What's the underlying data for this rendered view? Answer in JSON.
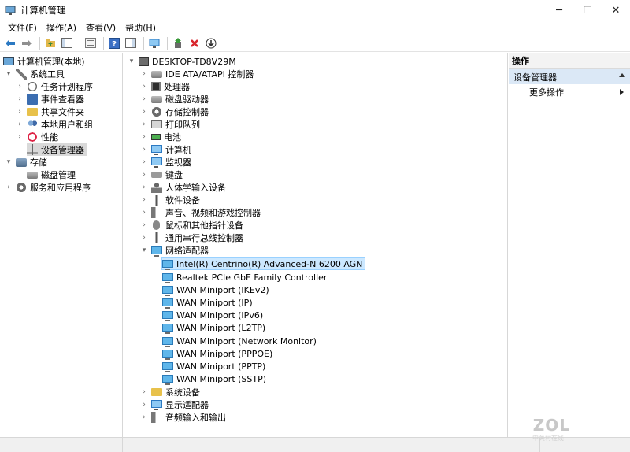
{
  "window": {
    "title": "计算机管理",
    "controls": [
      "─",
      "☐",
      "✕"
    ]
  },
  "menubar": {
    "items": [
      "文件(F)",
      "操作(A)",
      "查看(V)",
      "帮助(H)"
    ]
  },
  "toolbar": {
    "icons": [
      "back-icon",
      "forward-icon",
      "up-folder-icon",
      "show-hide-tree-icon",
      "properties-icon",
      "help-icon",
      "action-pane-icon",
      "scan-hardware-icon",
      "update-driver-icon",
      "uninstall-icon",
      "download-icon"
    ]
  },
  "left_tree": [
    {
      "label": "计算机管理(本地)",
      "icon": "computer-management-icon",
      "level": 0,
      "expander": ""
    },
    {
      "label": "系统工具",
      "icon": "tools-icon",
      "level": 1,
      "expander": "▾"
    },
    {
      "label": "任务计划程序",
      "icon": "clock-icon",
      "level": 2,
      "expander": "›"
    },
    {
      "label": "事件查看器",
      "icon": "event-viewer-icon",
      "level": 2,
      "expander": "›"
    },
    {
      "label": "共享文件夹",
      "icon": "shared-folder-icon",
      "level": 2,
      "expander": "›"
    },
    {
      "label": "本地用户和组",
      "icon": "users-icon",
      "level": 2,
      "expander": "›"
    },
    {
      "label": "性能",
      "icon": "performance-icon",
      "level": 2,
      "expander": "›"
    },
    {
      "label": "设备管理器",
      "icon": "device-manager-icon",
      "level": 2,
      "expander": "",
      "selected": true
    },
    {
      "label": "存储",
      "icon": "storage-icon",
      "level": 1,
      "expander": "▾"
    },
    {
      "label": "磁盘管理",
      "icon": "disk-management-icon",
      "level": 2,
      "expander": ""
    },
    {
      "label": "服务和应用程序",
      "icon": "services-icon",
      "level": 1,
      "expander": "›"
    }
  ],
  "device_tree": {
    "root": "DESKTOP-TD8V29M",
    "categories": [
      {
        "label": "IDE ATA/ATAPI 控制器",
        "icon": "ide-controller-icon",
        "expander": "›"
      },
      {
        "label": "处理器",
        "icon": "processor-icon",
        "expander": "›"
      },
      {
        "label": "磁盘驱动器",
        "icon": "disk-drive-icon",
        "expander": "›"
      },
      {
        "label": "存储控制器",
        "icon": "storage-controller-icon",
        "expander": "›"
      },
      {
        "label": "打印队列",
        "icon": "printer-icon",
        "expander": "›"
      },
      {
        "label": "电池",
        "icon": "battery-icon",
        "expander": "›"
      },
      {
        "label": "计算机",
        "icon": "computer-icon",
        "expander": "›"
      },
      {
        "label": "监视器",
        "icon": "monitor-icon",
        "expander": "›"
      },
      {
        "label": "键盘",
        "icon": "keyboard-icon",
        "expander": "›"
      },
      {
        "label": "人体学输入设备",
        "icon": "hid-icon",
        "expander": "›"
      },
      {
        "label": "软件设备",
        "icon": "software-device-icon",
        "expander": "›"
      },
      {
        "label": "声音、视频和游戏控制器",
        "icon": "sound-icon",
        "expander": "›"
      },
      {
        "label": "鼠标和其他指针设备",
        "icon": "mouse-icon",
        "expander": "›"
      },
      {
        "label": "通用串行总线控制器",
        "icon": "usb-icon",
        "expander": "›"
      },
      {
        "label": "网络适配器",
        "icon": "network-adapter-icon",
        "expander": "▾"
      }
    ],
    "network_adapters": [
      {
        "label": "Intel(R) Centrino(R) Advanced-N 6200 AGN",
        "focused": true
      },
      {
        "label": "Realtek PCIe GbE Family Controller"
      },
      {
        "label": "WAN Miniport (IKEv2)"
      },
      {
        "label": "WAN Miniport (IP)"
      },
      {
        "label": "WAN Miniport (IPv6)"
      },
      {
        "label": "WAN Miniport (L2TP)"
      },
      {
        "label": "WAN Miniport (Network Monitor)"
      },
      {
        "label": "WAN Miniport (PPPOE)"
      },
      {
        "label": "WAN Miniport (PPTP)"
      },
      {
        "label": "WAN Miniport (SSTP)"
      }
    ],
    "trailing_categories": [
      {
        "label": "系统设备",
        "icon": "system-device-icon",
        "expander": "›"
      },
      {
        "label": "显示适配器",
        "icon": "display-adapter-icon",
        "expander": "›"
      },
      {
        "label": "音频输入和输出",
        "icon": "audio-io-icon",
        "expander": "›"
      }
    ]
  },
  "actions": {
    "header": "操作",
    "group": "设备管理器",
    "more": "更多操作"
  },
  "watermark": {
    "logo": "ZOL",
    "sub": "中关村在线"
  },
  "colors": {
    "selection": "#d9d9d9",
    "focus": "#cce8ff",
    "action_group_bg": "#dbe8f6",
    "uninstall_red": "#d9272e",
    "accent_blue": "#2b79c2"
  }
}
